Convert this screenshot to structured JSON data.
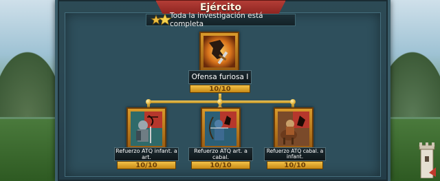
{
  "title": "Ejército",
  "completion": {
    "text": "Toda la investigación está completa",
    "icon": "stars-icon"
  },
  "skills": {
    "top": {
      "name": "Ofensa furiosa I",
      "progress": "10/10",
      "icon": "sword-fist-icon"
    },
    "left": {
      "name": "Refuerzo ATQ infant. a art.",
      "progress": "10/10",
      "icon": "infantry-vs-archer-icon"
    },
    "middle": {
      "name": "Refuerzo ATQ art. a cabal.",
      "progress": "10/10",
      "icon": "archer-vs-cavalry-icon"
    },
    "right": {
      "name": "Refuerzo ATQ cabal. a infant.",
      "progress": "10/10",
      "icon": "cavalry-vs-infantry-icon"
    }
  },
  "colors": {
    "panel": "#2e4f5c",
    "ribbon": "#b33d36",
    "gold": "#e5b640"
  },
  "corner_icon": "castle-tower-icon"
}
